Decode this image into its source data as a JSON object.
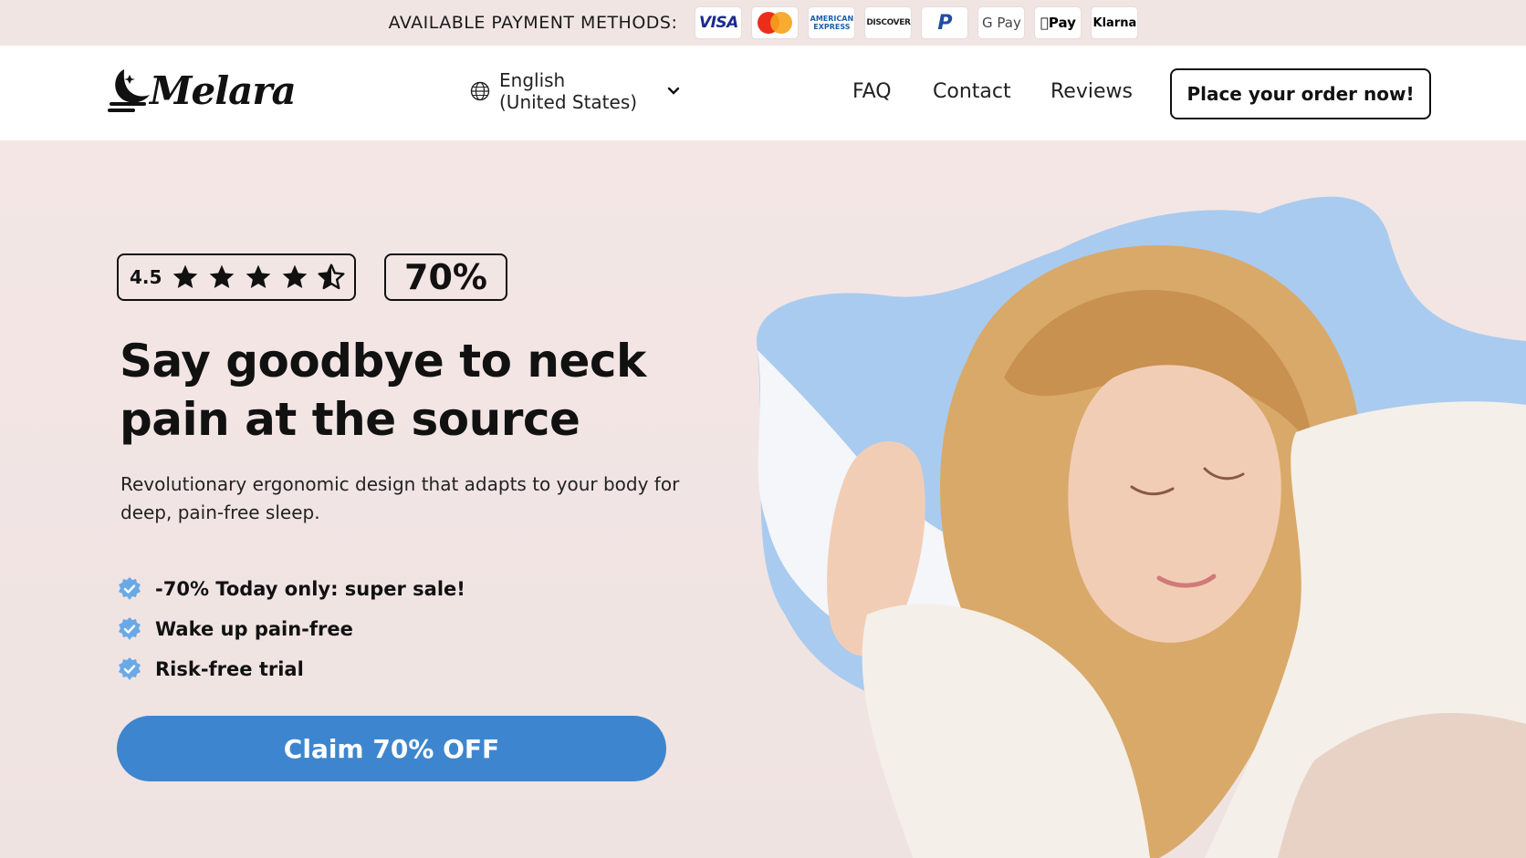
{
  "payment_bar": {
    "label": "AVAILABLE PAYMENT METHODS:",
    "methods": [
      {
        "name": "visa",
        "label": "VISA"
      },
      {
        "name": "mastercard",
        "label": ""
      },
      {
        "name": "american-express",
        "label": "AMERICAN EXPRESS"
      },
      {
        "name": "discover",
        "label": "DISCOVER"
      },
      {
        "name": "paypal",
        "label": "P"
      },
      {
        "name": "google-pay",
        "label": "G Pay"
      },
      {
        "name": "apple-pay",
        "label": "Pay"
      },
      {
        "name": "klarna",
        "label": "Klarna"
      }
    ]
  },
  "header": {
    "logo_text": "Melara",
    "language_line1": "English",
    "language_line2": "(United States)",
    "nav": {
      "faq": "FAQ",
      "contact": "Contact",
      "reviews": "Reviews"
    },
    "order_button": "Place your order now!"
  },
  "hero": {
    "rating": "4.5",
    "stars": 4.5,
    "discount_badge": "70%",
    "headline": "Say goodbye to neck pain at the source",
    "subtext": "Revolutionary ergonomic design that adapts to your body for deep, pain-free sleep.",
    "benefits": [
      "-70% Today only: super sale!",
      "Wake up pain-free",
      "Risk-free trial"
    ],
    "cta": "Claim 70% OFF"
  },
  "colors": {
    "accent": "#3d86cf",
    "check_badge": "#6aa9e6",
    "background": "#f2e6e5",
    "pillow": "#a9cbef"
  },
  "icons": [
    "globe-icon",
    "chevron-down-icon",
    "star-icon",
    "half-star-icon",
    "check-badge-icon"
  ]
}
